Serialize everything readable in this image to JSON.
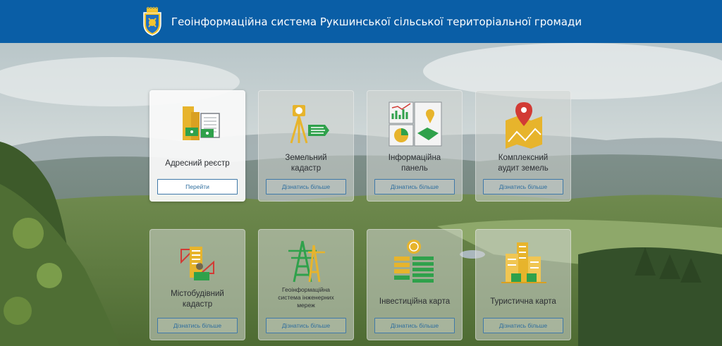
{
  "header": {
    "title": "Геоінформаційна система Рукшинської сільської територіальної громади"
  },
  "colors": {
    "header_bg": "#0a5ea6",
    "accent_yellow": "#e7b42c",
    "accent_green": "#2fa14b",
    "accent_red": "#d23b35",
    "button_border": "#3f79a8"
  },
  "cards": [
    {
      "label": "Адресний реєстр",
      "button": "Перейти",
      "icon": "address-registry-icon",
      "active": true
    },
    {
      "label": "Земельний кадастр",
      "label_lines": [
        "Земельний",
        "кадастр"
      ],
      "button": "Дізнатись більше",
      "icon": "land-survey-icon"
    },
    {
      "label": "Інформаційна панель",
      "label_lines": [
        "Інформаційна",
        "панель"
      ],
      "button": "Дізнатись більше",
      "icon": "dashboard-icon"
    },
    {
      "label": "Комплексний аудит земель",
      "label_lines": [
        "Комплексний",
        "аудит земель"
      ],
      "button": "Дізнатись більше",
      "icon": "map-pin-icon"
    },
    {
      "label": "Містобудівний кадастр",
      "label_lines": [
        "Містобудівний",
        "кадастр"
      ],
      "button": "Дізнатись більше",
      "icon": "urban-cadastre-icon"
    },
    {
      "label": "Геоінформаційна система інженерних мереж",
      "label_lines": [
        "Геоінформаційна",
        "система інженерних",
        "мереж"
      ],
      "button": "Дізнатись більше",
      "icon": "power-tower-icon"
    },
    {
      "label": "Інвестиційна карта",
      "button": "Дізнатись більше",
      "icon": "coins-icon"
    },
    {
      "label": "Туристична карта",
      "button": "Дізнатись більше",
      "icon": "tourism-city-icon"
    }
  ]
}
